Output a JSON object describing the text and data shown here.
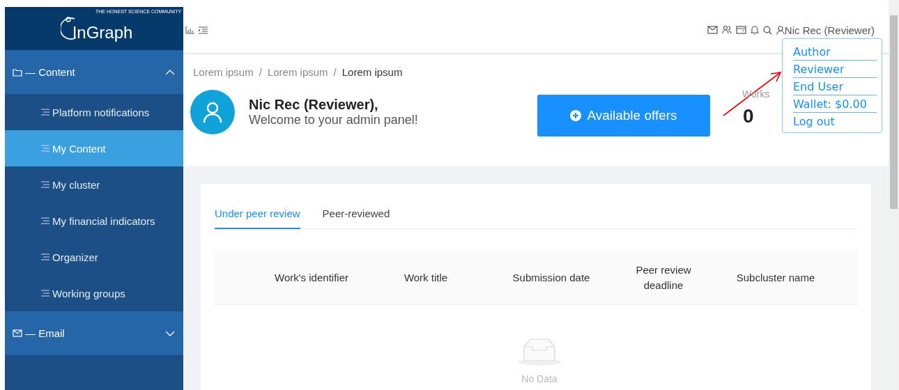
{
  "logo": {
    "name": "InGraph",
    "tagline": "THE HONEST SCIENCE COMMUNITY"
  },
  "sidebar": {
    "sections": [
      {
        "label": "— Content",
        "expanded": true,
        "items": [
          {
            "label": "Platform notifications",
            "selected": false
          },
          {
            "label": "My Content",
            "selected": true
          },
          {
            "label": "My cluster",
            "selected": false
          },
          {
            "label": "My financial indicators",
            "selected": false
          },
          {
            "label": "Organizer",
            "selected": false
          },
          {
            "label": "Working groups",
            "selected": false
          }
        ]
      },
      {
        "label": "— Email",
        "expanded": false
      }
    ]
  },
  "header": {
    "user": "Nic Rec (Reviewer)"
  },
  "user_menu": [
    "Author",
    "Reviewer",
    "End User",
    "Wallet: $0.00",
    "Log out"
  ],
  "breadcrumb": [
    "Lorem ipsum",
    "Lorem ipsum",
    "Lorem ipsum"
  ],
  "breadcrumb_separator": "/",
  "welcome": {
    "name": "Nic Rec (Reviewer),",
    "message": "Welcome to your admin panel!"
  },
  "offers_button": "Available offers",
  "stats": [
    {
      "label": "Works",
      "value": "0"
    }
  ],
  "tabs": [
    {
      "label": "Under peer review",
      "selected": true
    },
    {
      "label": "Peer-reviewed",
      "selected": false
    }
  ],
  "table": {
    "columns": [
      "Work's identifier",
      "Work title",
      "Submission date",
      "Peer review deadline",
      "Subcluster name"
    ],
    "empty_text": "No Data"
  }
}
